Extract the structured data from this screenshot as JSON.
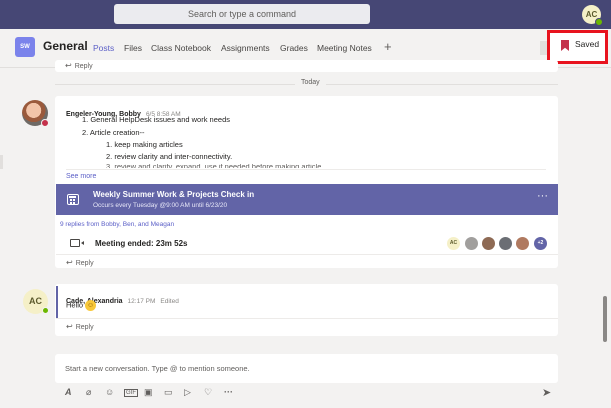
{
  "search": {
    "placeholder": "Search or type a command"
  },
  "user": {
    "initials": "AC"
  },
  "channel": {
    "team_initials": "SW",
    "name": "General",
    "tabs": [
      "Posts",
      "Files",
      "Class Notebook",
      "Assignments",
      "Grades",
      "Meeting Notes"
    ],
    "active_tab": "Posts",
    "add_tab_icon": "plus-icon"
  },
  "saved_button": {
    "label": "Saved",
    "icon": "bookmark-icon"
  },
  "feed": {
    "prev_reply_label": "Reply",
    "day_separator": "Today",
    "post1": {
      "author": "Engeler-Young, Bobby",
      "timestamp": "6/5 8:58 AM",
      "lines": [
        "1. General HelpDesk issues and work needs",
        "2. Article creation--",
        "1. keep making articles",
        "2. review clarity and inter-connectivity.",
        "3. review and clarify, expand, use if needed before making article"
      ],
      "see_more": "See more",
      "meeting": {
        "title": "Weekly Summer Work & Projects Check in",
        "subtitle": "Occurs every Tuesday @9:00 AM until 6/23/20",
        "more_icon": "more-icon"
      },
      "replies_from": "9 replies from Bobby, Ben, and Meagan",
      "meeting_ended": "Meeting ended: 23m 52s",
      "participants": [
        "AC",
        "+2"
      ],
      "reply_label": "Reply"
    },
    "post2": {
      "author": "Cade, Alexandria",
      "timestamp": "12:17 PM",
      "edited": "Edited",
      "avatar_initials": "AC",
      "message": "Hello",
      "reply_label": "Reply"
    }
  },
  "compose": {
    "placeholder": "Start a new conversation. Type @ to mention someone.",
    "tools": [
      "format-icon",
      "attach-icon",
      "emoji-icon",
      "gif-icon",
      "sticker-icon",
      "meet-now-icon",
      "stream-icon",
      "praise-icon",
      "more-options-icon"
    ],
    "send_icon": "send-icon"
  },
  "colors": {
    "title_bar": "#464775",
    "accent": "#5b5fc7",
    "meeting_banner": "#6264a7",
    "highlight_box": "#e8131e"
  }
}
